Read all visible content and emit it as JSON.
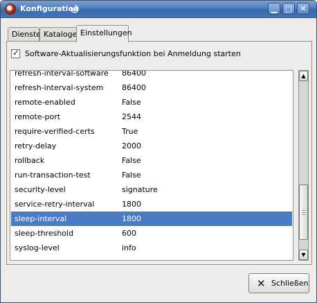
{
  "window": {
    "title": "Konfiguration",
    "controls": {
      "minimize": "▁",
      "maximize": "□",
      "close": "✕"
    }
  },
  "tabs": [
    {
      "label": "Dienste",
      "active": false
    },
    {
      "label": "Kataloge",
      "active": false
    },
    {
      "label": "Einstellungen",
      "active": true
    }
  ],
  "checkbox": {
    "label": "Software-Aktualisierungsfunktion bei Anmeldung starten",
    "checked": true,
    "mark": "✓"
  },
  "settings": {
    "rows": [
      {
        "key": "refresh-interval-software",
        "value": "86400"
      },
      {
        "key": "refresh-interval-system",
        "value": "86400"
      },
      {
        "key": "remote-enabled",
        "value": "False"
      },
      {
        "key": "remote-port",
        "value": "2544"
      },
      {
        "key": "require-verified-certs",
        "value": "True"
      },
      {
        "key": "retry-delay",
        "value": "2000"
      },
      {
        "key": "rollback",
        "value": "False"
      },
      {
        "key": "run-transaction-test",
        "value": "False"
      },
      {
        "key": "security-level",
        "value": "signature"
      },
      {
        "key": "service-retry-interval",
        "value": "1800"
      },
      {
        "key": "sleep-interval",
        "value": "1800"
      },
      {
        "key": "sleep-threshold",
        "value": "600"
      },
      {
        "key": "syslog-level",
        "value": "info"
      }
    ],
    "selected_key": "sleep-interval"
  },
  "scrollbar": {
    "up": "▲",
    "down": "▼"
  },
  "buttons": {
    "close_label": "Schließen",
    "close_icon": "✕"
  },
  "colors": {
    "selection": "#4a7cc6",
    "titlebar": "#4f7dbd"
  }
}
